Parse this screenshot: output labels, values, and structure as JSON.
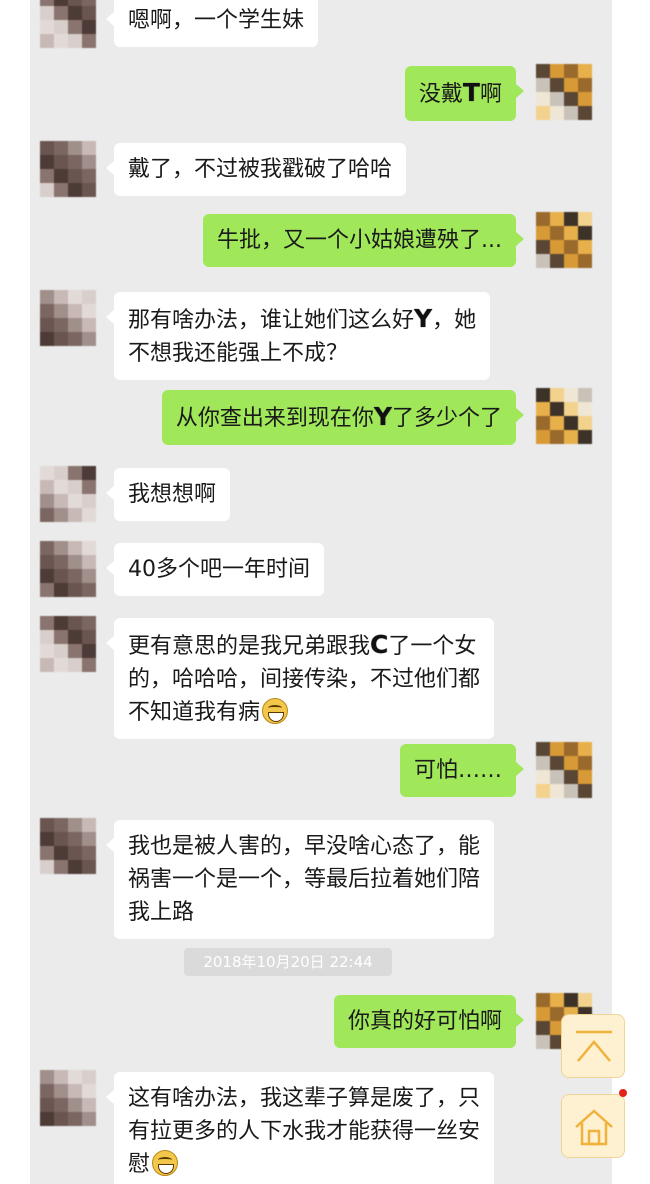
{
  "colors": {
    "chat_background": "#ebebeb",
    "sent_bubble": "#a0e75a",
    "received_bubble": "#ffffff",
    "timestamp_chip": "#dadada",
    "float_button": "#fdf1d2",
    "notification_dot": "#e2231a"
  },
  "messages": [
    {
      "side": "left",
      "lines": [
        {
          "parts": [
            {
              "t": "嗯啊，一个学生妹"
            }
          ]
        }
      ]
    },
    {
      "side": "right",
      "lines": [
        {
          "parts": [
            {
              "t": "没戴"
            },
            {
              "t": "T",
              "censored": true
            },
            {
              "t": "啊"
            }
          ]
        }
      ]
    },
    {
      "side": "left",
      "lines": [
        {
          "parts": [
            {
              "t": "戴了，不过被我戳破了哈哈"
            }
          ]
        }
      ]
    },
    {
      "side": "right",
      "lines": [
        {
          "parts": [
            {
              "t": "牛批，又一个小姑娘遭殃了..."
            }
          ]
        }
      ]
    },
    {
      "side": "left",
      "lines": [
        {
          "parts": [
            {
              "t": "那有啥办法，谁让她们这么好"
            },
            {
              "t": "Y",
              "censored": true
            },
            {
              "t": "，她"
            }
          ]
        },
        {
          "parts": [
            {
              "t": "不想我还能强上不成？"
            }
          ]
        }
      ]
    },
    {
      "side": "right",
      "lines": [
        {
          "parts": [
            {
              "t": "从你查出来到现在你"
            },
            {
              "t": "Y",
              "censored": true
            },
            {
              "t": "了多少个了"
            }
          ]
        }
      ]
    },
    {
      "side": "left",
      "lines": [
        {
          "parts": [
            {
              "t": "我想想啊"
            }
          ]
        }
      ]
    },
    {
      "side": "left",
      "lines": [
        {
          "parts": [
            {
              "t": "40多个吧一年时间"
            }
          ]
        }
      ]
    },
    {
      "side": "left",
      "lines": [
        {
          "parts": [
            {
              "t": "更有意思的是我兄弟跟我"
            },
            {
              "t": "C",
              "censored": true
            },
            {
              "t": "了一个女"
            }
          ]
        },
        {
          "parts": [
            {
              "t": "的，哈哈哈，间接传染，不过他们都"
            }
          ]
        },
        {
          "parts": [
            {
              "t": "不知道我有病"
            },
            {
              "emoji": "grin-emoji"
            }
          ]
        }
      ]
    },
    {
      "side": "right",
      "lines": [
        {
          "parts": [
            {
              "t": "可怕……"
            }
          ]
        }
      ]
    },
    {
      "side": "left",
      "lines": [
        {
          "parts": [
            {
              "t": "我也是被人害的，早没啥心态了，能"
            }
          ]
        },
        {
          "parts": [
            {
              "t": "祸害一个是一个，等最后拉着她们陪"
            }
          ]
        },
        {
          "parts": [
            {
              "t": "我上路"
            }
          ]
        }
      ]
    },
    {
      "side": "right",
      "lines": [
        {
          "parts": [
            {
              "t": "你真的好可怕啊"
            }
          ]
        }
      ]
    },
    {
      "side": "left",
      "lines": [
        {
          "parts": [
            {
              "t": "这有啥办法，我这辈子算是废了，只"
            }
          ]
        },
        {
          "parts": [
            {
              "t": "有拉更多的人下水我才能获得一丝安"
            }
          ]
        },
        {
          "parts": [
            {
              "t": "慰"
            },
            {
              "emoji": "grin-emoji"
            }
          ]
        }
      ]
    }
  ],
  "timestamp": "2018年10月20日 22:44",
  "float_buttons": [
    {
      "icon": "back-to-top-icon"
    },
    {
      "icon": "home-icon"
    }
  ]
}
